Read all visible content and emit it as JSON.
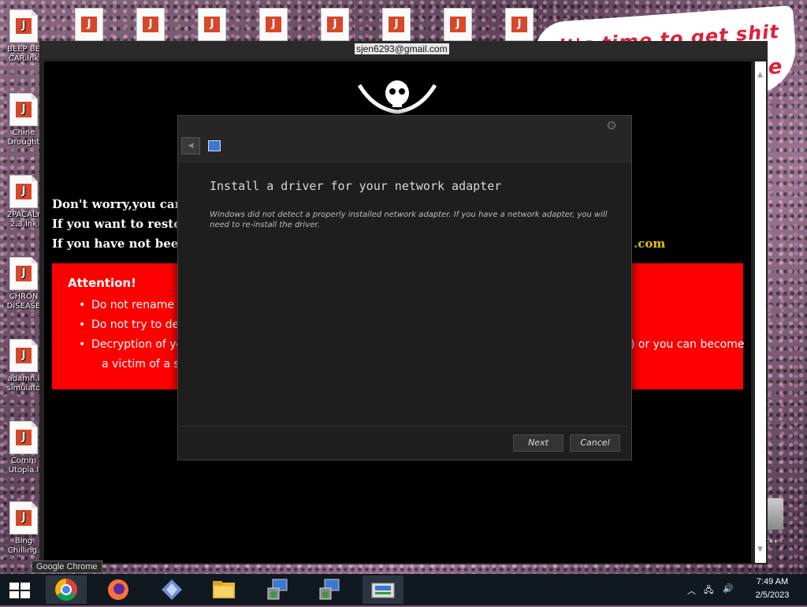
{
  "window": {
    "email": "sjen6293@gmail.com"
  },
  "desktop": {
    "graffiti_line1": "it's time to get shit",
    "graffiti_line2": "te",
    "icons": [
      {
        "label": "BEEP BE\nCAR.lnk"
      },
      {
        "label": "Chine\nDrought"
      },
      {
        "label": "2PACALY\n2.3.lnk"
      },
      {
        "label": "CHRON\nDISEASE"
      },
      {
        "label": "adamn.l\nsimulato"
      },
      {
        "label": "Comm\nUtopia.l"
      },
      {
        "label": "Bing\nChilling."
      }
    ],
    "right_label": "n C++"
  },
  "ransom": {
    "line1": "Don't worry,you can r",
    "line2": "If you want to restore",
    "line3": "If you have not been a",
    "line3_suffix": ".com",
    "attention": {
      "heading": "Attention!",
      "item1": "Do not rename e",
      "item2": "Do not try to dec",
      "item3_start": "Decryption of yo",
      "item3_end": ") or you can become",
      "item3_cont": "a victim of a sca"
    }
  },
  "dialog": {
    "title": "Install a driver for your network adapter",
    "description": "Windows did not detect a properly installed network adapter. If you have a network adapter, you will need to re-install the driver.",
    "next_label": "Next",
    "cancel_label": "Cancel"
  },
  "taskbar": {
    "tooltip": "Google Chrome",
    "time": "7:49 AM",
    "date": "2/5/2023",
    "apps": [
      "start-icon",
      "chrome-icon",
      "firefox-icon",
      "app-diamond-icon",
      "file-explorer-icon",
      "network-setup-icon",
      "network-setup-icon",
      "network-adapter-icon"
    ]
  },
  "colors": {
    "ransom_red": "#ff0000",
    "dotcom_yellow": "#e7c300",
    "dialog_bg": "#1e1e1e"
  }
}
